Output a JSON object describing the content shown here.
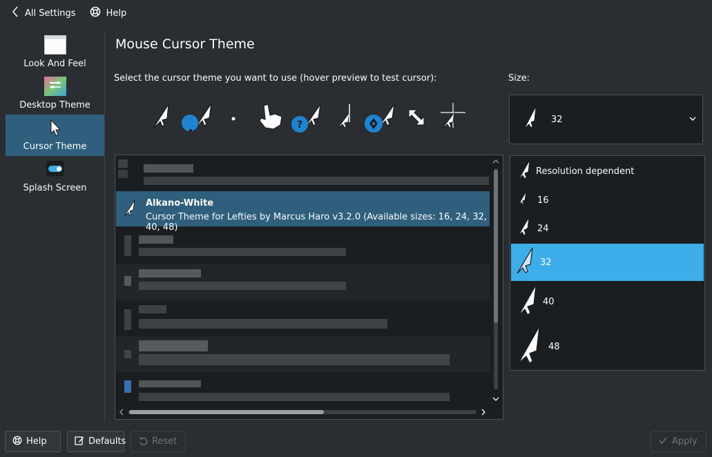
{
  "topbar": {
    "back_label": "All Settings",
    "help_label": "Help"
  },
  "sidebar": {
    "items": [
      {
        "label": "Look And Feel",
        "icon": "look-and-feel-icon"
      },
      {
        "label": "Desktop Theme",
        "icon": "desktop-theme-icon"
      },
      {
        "label": "Cursor Theme",
        "icon": "cursor-theme-icon",
        "active": true
      },
      {
        "label": "Splash Screen",
        "icon": "splash-screen-icon"
      }
    ]
  },
  "page": {
    "title": "Mouse Cursor Theme",
    "instruction": "Select the cursor theme you want to use (hover preview to test cursor):",
    "size_label": "Size:"
  },
  "size_combo": {
    "value": "32"
  },
  "theme_list": {
    "selected": {
      "name": "Alkano-White",
      "description": "Cursor Theme for Lefties by Marcus Haro v3.2.0 (Available sizes: 16, 24, 32, 40, 48)"
    }
  },
  "size_list": {
    "items": [
      {
        "label": "Resolution dependent"
      },
      {
        "label": "16"
      },
      {
        "label": "24"
      },
      {
        "label": "32",
        "selected": true
      },
      {
        "label": "40"
      },
      {
        "label": "48"
      }
    ]
  },
  "bottom": {
    "help_label": "Help",
    "defaults_label": "Defaults",
    "reset_label": "Reset",
    "apply_label": "Apply"
  },
  "colors": {
    "accent": "#3daee9",
    "selection": "#2f5f7d",
    "background": "#2a2e32",
    "view": "#1b1e20"
  }
}
